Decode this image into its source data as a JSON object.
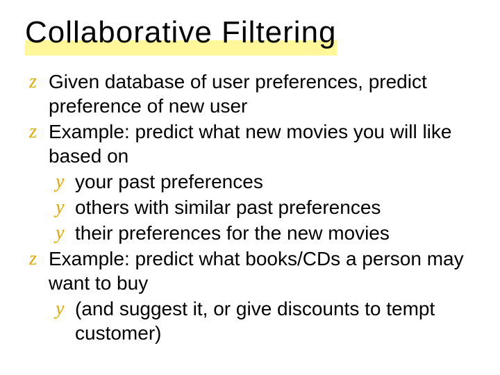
{
  "title": "Collaborative Filtering",
  "bullets": {
    "b1": "Given database of user preferences,  predict preference of new user",
    "b2": "Example: predict what new movies you will like based on",
    "b2_1": "your past preferences",
    "b2_2": "others with similar past preferences",
    "b2_3": "their preferences for the new movies",
    "b3": "Example: predict what books/CDs a person may want to buy",
    "b3_1": "(and suggest it, or give discounts to tempt customer)"
  }
}
